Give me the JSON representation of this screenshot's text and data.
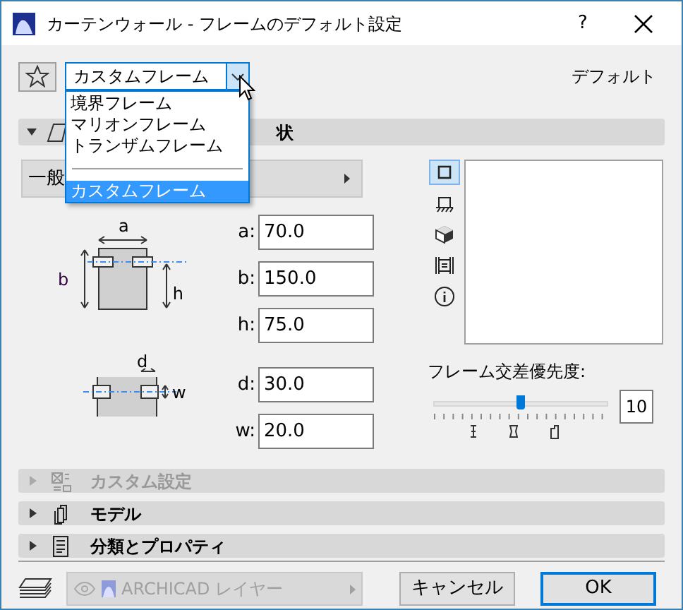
{
  "window": {
    "title": "カーテンウォール - フレームのデフォルト設定",
    "help": "?"
  },
  "favorite_combo": {
    "value": "カスタムフレーム",
    "expanded": true
  },
  "dropdown_list": [
    {
      "kind": "option",
      "label": "境界フレーム",
      "selected": false
    },
    {
      "kind": "option",
      "label": "マリオンフレーム",
      "selected": false
    },
    {
      "kind": "option",
      "label": "トランザムフレーム",
      "selected": false
    },
    {
      "kind": "separator"
    },
    {
      "kind": "option",
      "label": "カスタムフレーム",
      "selected": true
    }
  ],
  "default_label": "デフォルト",
  "section_header": {
    "title": "状",
    "expanded": true
  },
  "panel_dropdown": {
    "value": "一般"
  },
  "profile_diagram": {
    "labels": [
      "a",
      "b",
      "h"
    ]
  },
  "profile_fields": [
    {
      "label": "a:",
      "value": "70.0"
    },
    {
      "label": "b:",
      "value": "150.0"
    },
    {
      "label": "h:",
      "value": "75.0"
    }
  ],
  "offset_diagram": {
    "labels": [
      "d",
      "w"
    ]
  },
  "offset_fields": [
    {
      "label": "d:",
      "value": "30.0"
    },
    {
      "label": "w:",
      "value": "20.0"
    }
  ],
  "view_buttons": [
    {
      "kind": "plan",
      "selected": true
    },
    {
      "kind": "section",
      "selected": false
    },
    {
      "kind": "cube",
      "selected": false
    },
    {
      "kind": "list",
      "selected": false
    },
    {
      "kind": "info",
      "selected": false
    }
  ],
  "priority": {
    "label": "フレーム交差優先度:",
    "level": 0.5,
    "value": "10"
  },
  "sections": [
    {
      "kind": "custom",
      "title": "カスタム設定",
      "enabled": false,
      "expanded": false
    },
    {
      "kind": "model",
      "title": "モデル",
      "enabled": true,
      "expanded": false
    },
    {
      "kind": "classification",
      "title": "分類とプロパティ",
      "enabled": true,
      "expanded": false
    }
  ],
  "layer": {
    "value": "ARCHICAD レイヤー",
    "disabled": true
  },
  "buttons": [
    {
      "label": "キャンセル",
      "default": false
    },
    {
      "label": "OK",
      "default": true
    }
  ]
}
